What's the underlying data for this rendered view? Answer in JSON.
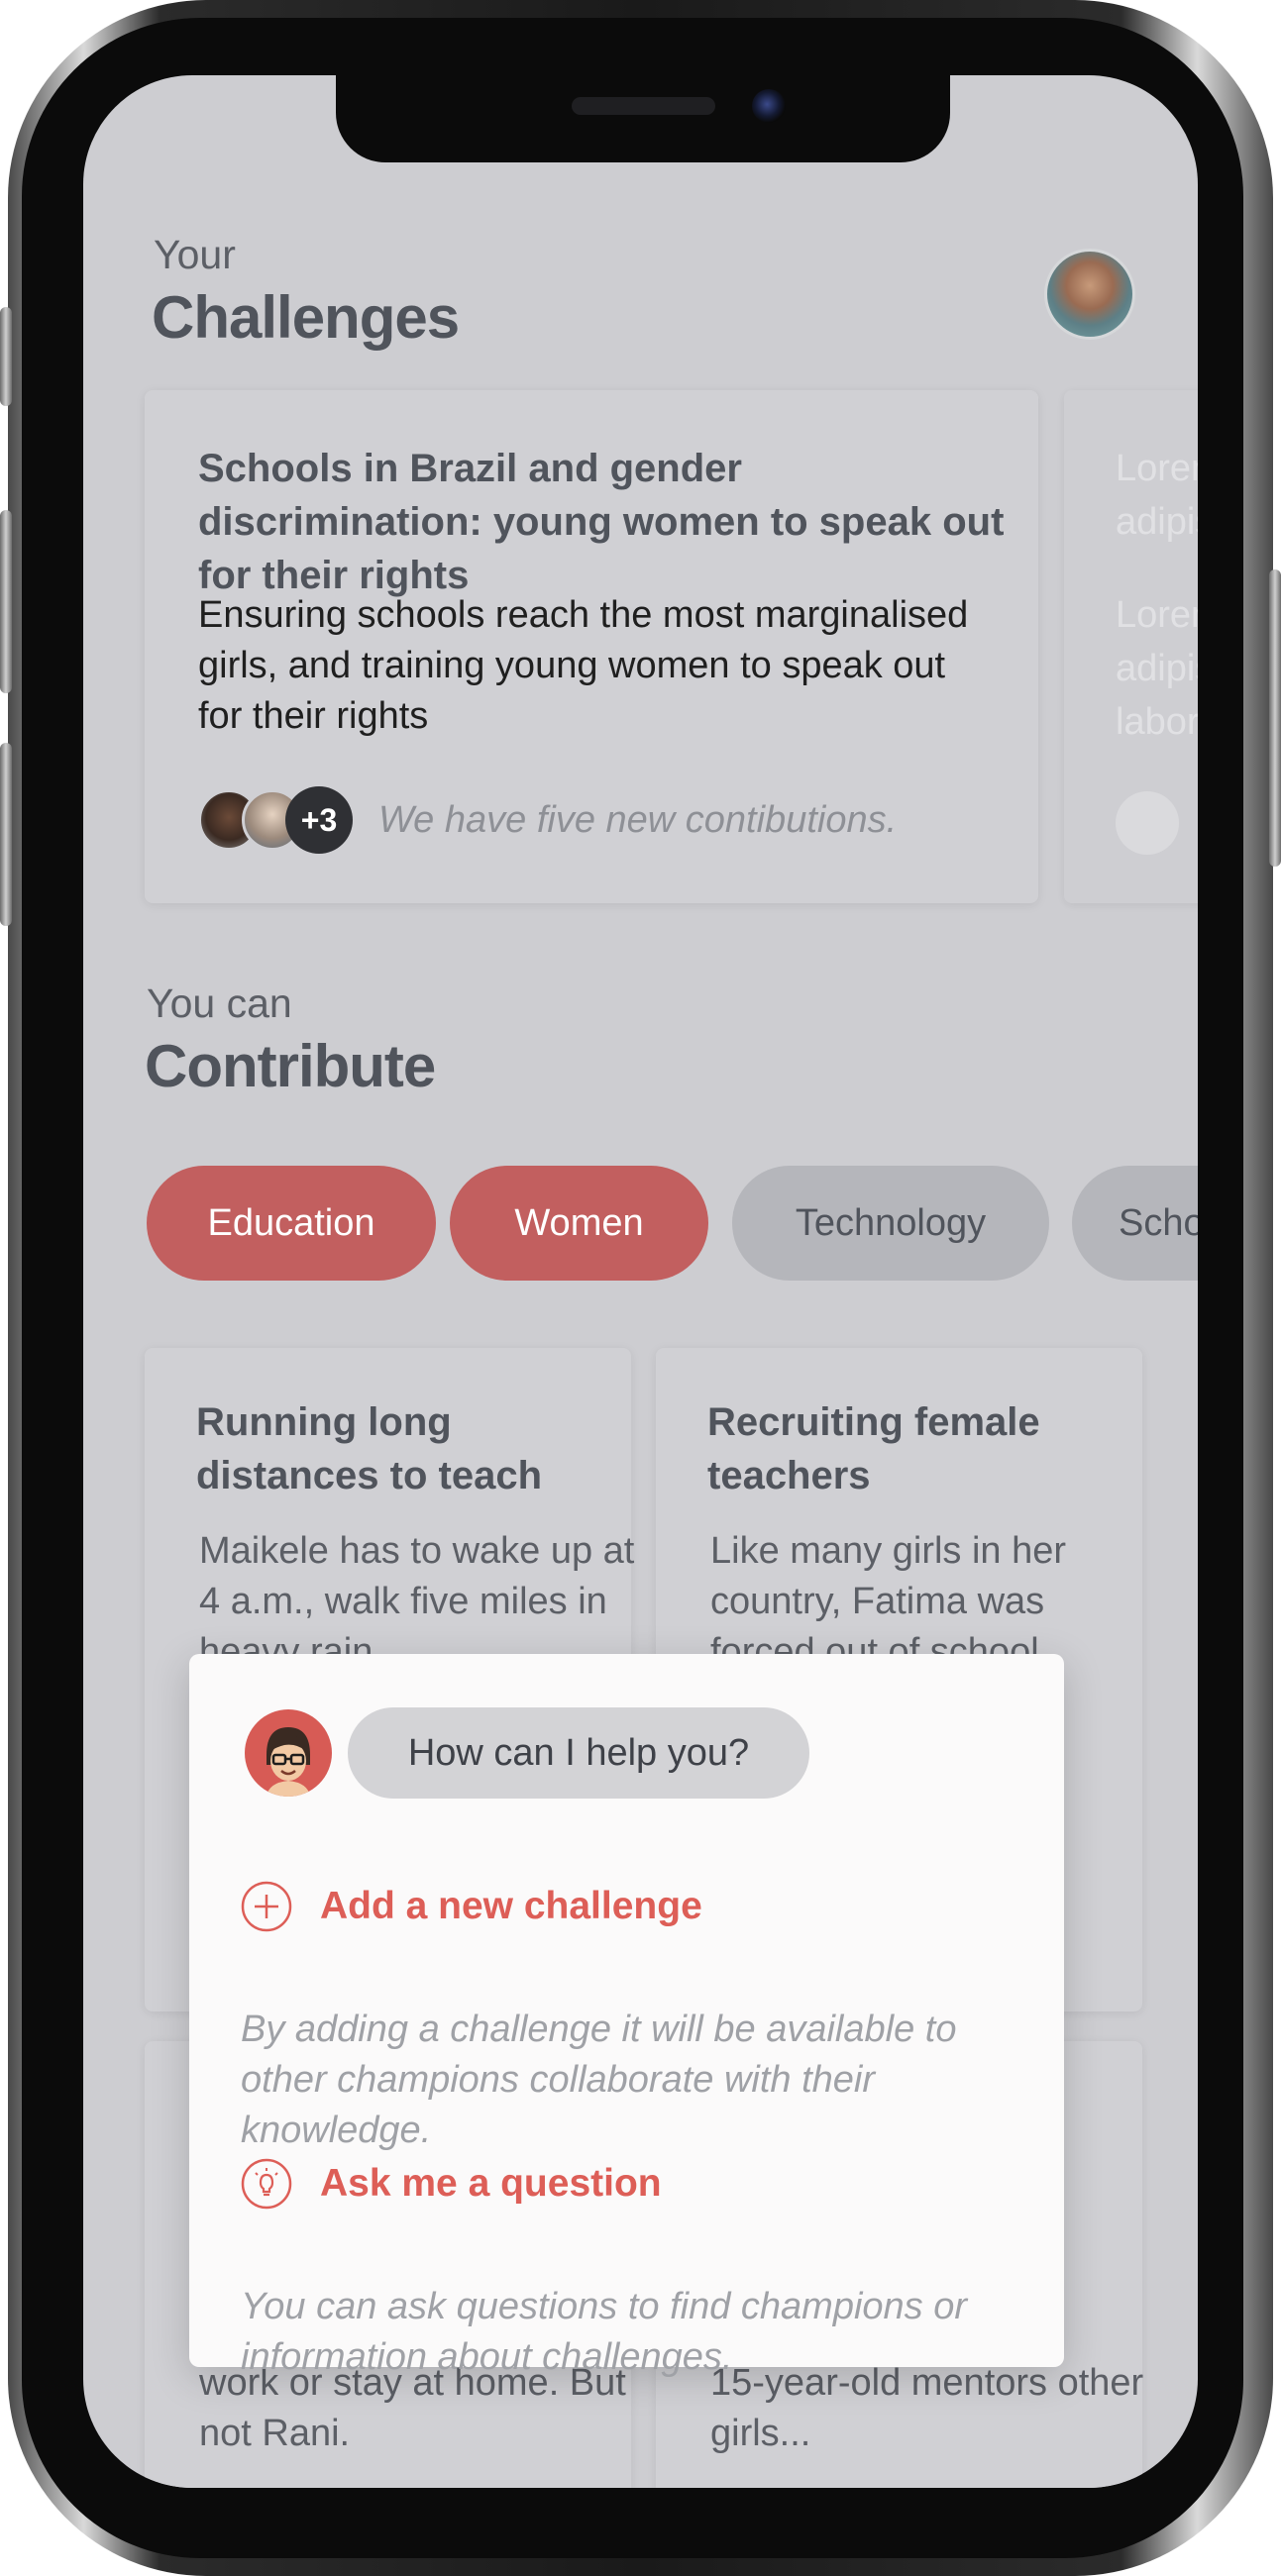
{
  "header": {
    "eyebrow": "Your",
    "title": "Challenges"
  },
  "challenge_card": {
    "title": "Schools in Brazil and gender discrimination: young women to speak out for their rights",
    "body": "Ensuring schools reach the most marginalised girls,  and training young women to speak out for their rights",
    "more_count": "+3",
    "contributions_text": "We have five new contibutions."
  },
  "challenge_card_next": {
    "title": "Lorem ipsum dolor sit amet, consectetur adipiscing",
    "body": "Lorem ipsum dolor sit amet, consectetur adipiscing elit, sed do eiusmod tempor ut labore"
  },
  "contribute": {
    "eyebrow": "You can",
    "title": "Contribute"
  },
  "chips": [
    {
      "label": "Education",
      "active": true
    },
    {
      "label": "Women",
      "active": true
    },
    {
      "label": "Technology",
      "active": false
    },
    {
      "label": "Schools",
      "active": false
    }
  ],
  "stories": [
    {
      "title": "Running long distances to teach",
      "body": "Maikele has to wake up at 4 a.m., walk five miles in heavy rain"
    },
    {
      "title": "Recruiting female teachers",
      "body": "Like many girls in her country, Fatima was forced out of school"
    },
    {
      "title": "",
      "body": "work or stay at home. But not Rani."
    },
    {
      "title": "",
      "body": "15-year-old mentors other girls..."
    }
  ],
  "assistant": {
    "greeting": "How can I help you?",
    "actions": [
      {
        "icon": "plus-circle-icon",
        "label": "Add a new challenge",
        "description": "By adding a challenge it will be available to other champions collaborate with their knowledge."
      },
      {
        "icon": "lightbulb-icon",
        "label": "Ask me a question",
        "description": "You can ask questions to find champions or information about challenges."
      }
    ]
  },
  "colors": {
    "accent": "#dd5e57",
    "chip_active": "#c25f5f",
    "chip_inactive": "#b5b6bb",
    "screen_bg": "#cdcdd1"
  }
}
